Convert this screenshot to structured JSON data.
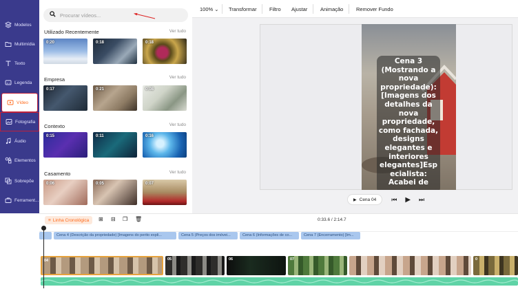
{
  "sidebar": {
    "items": [
      {
        "label": "Modelos",
        "icon": "templates-icon"
      },
      {
        "label": "Multimídia",
        "icon": "folder-icon"
      },
      {
        "label": "Texto",
        "icon": "text-icon"
      },
      {
        "label": "Legenda",
        "icon": "caption-icon"
      },
      {
        "label": "Vídeo",
        "icon": "video-icon"
      },
      {
        "label": "Fotografia",
        "icon": "photo-icon"
      },
      {
        "label": "Áudio",
        "icon": "music-icon"
      },
      {
        "label": "Elementos",
        "icon": "elements-icon"
      },
      {
        "label": "Sobrepõe",
        "icon": "overlay-icon"
      },
      {
        "label": "Ferrament...",
        "icon": "tools-icon"
      }
    ]
  },
  "search": {
    "placeholder": "Procurar vídeos..."
  },
  "sections": [
    {
      "title": "Utilizado Recentemente",
      "see_all": "Ver tudo",
      "durations": [
        "0:20",
        "0:18",
        "0:18"
      ]
    },
    {
      "title": "Empresa",
      "see_all": "Ver tudo",
      "durations": [
        "0:17",
        "0:21",
        "0:08"
      ]
    },
    {
      "title": "Contexto",
      "see_all": "Ver tudo",
      "durations": [
        "0:15",
        "0:11",
        "0:16"
      ]
    },
    {
      "title": "Casamento",
      "see_all": "Ver tudo",
      "durations": [
        "0:06",
        "0:05",
        "0:07"
      ]
    }
  ],
  "toolbar": {
    "zoom": "100%",
    "transform": "Transformar",
    "filter": "Filtro",
    "adjust": "Ajustar",
    "animation": "Animação",
    "remove_bg": "Remover Fundo"
  },
  "preview": {
    "caption": "Cena 3\n(Mostrando a\nnova\npropriedade):\n[Imagens dos\ndetalhes da\nnova\npropriedade,\ncomo fachada,\ndesigns\nelegantes e\ninteriores\nelegantes]Esp\necialista:\nAcabei de",
    "scene_label": "Cena 04"
  },
  "timeline": {
    "toggle_label": "Linha Cronológica",
    "time": "0:33.6 / 2:14.7",
    "scenes": [
      "Cena 4 (Descrição da propriedade) [Imagens do perito expli...",
      "Cena 5 (Preços dos imóvei...",
      "Cena 6 (Informações de co...",
      "Cena 7 (Encerramento) [Im..."
    ],
    "clips": [
      {
        "num": "04"
      },
      {
        "num": "05"
      },
      {
        "num": "06"
      },
      {
        "num": "07"
      },
      {
        "num": ""
      },
      {
        "num": "0"
      }
    ]
  },
  "colors": {
    "rail": "#3a3a8c",
    "accent": "#ff6a1c",
    "highlight_border": "#c0203a",
    "scene_chip": "#a9c7ee",
    "audio": "#5fd3a6"
  }
}
